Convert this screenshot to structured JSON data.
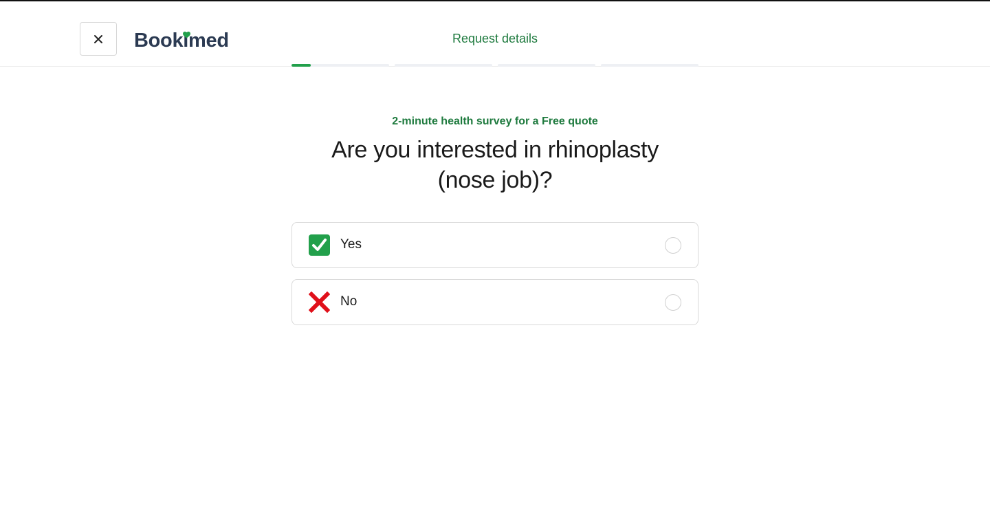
{
  "header": {
    "logo_text": "Bookimed",
    "title": "Request details",
    "close_icon": "close-icon"
  },
  "progress": {
    "steps": 5,
    "current_step": 1,
    "current_step_fill": 0.2,
    "accent_color": "#22a04b"
  },
  "survey": {
    "subtitle": "2-minute health survey for a Free quote",
    "question": "Are you interested in rhinoplasty (nose job)?",
    "options": [
      {
        "label": "Yes",
        "icon": "check-mark-icon",
        "selected": false
      },
      {
        "label": "No",
        "icon": "cross-mark-icon",
        "selected": false
      }
    ]
  },
  "colors": {
    "brand_green": "#1e7a3e",
    "logo_navy": "#2b3a52",
    "check_green": "#22a04b",
    "cross_red": "#e0101a"
  }
}
